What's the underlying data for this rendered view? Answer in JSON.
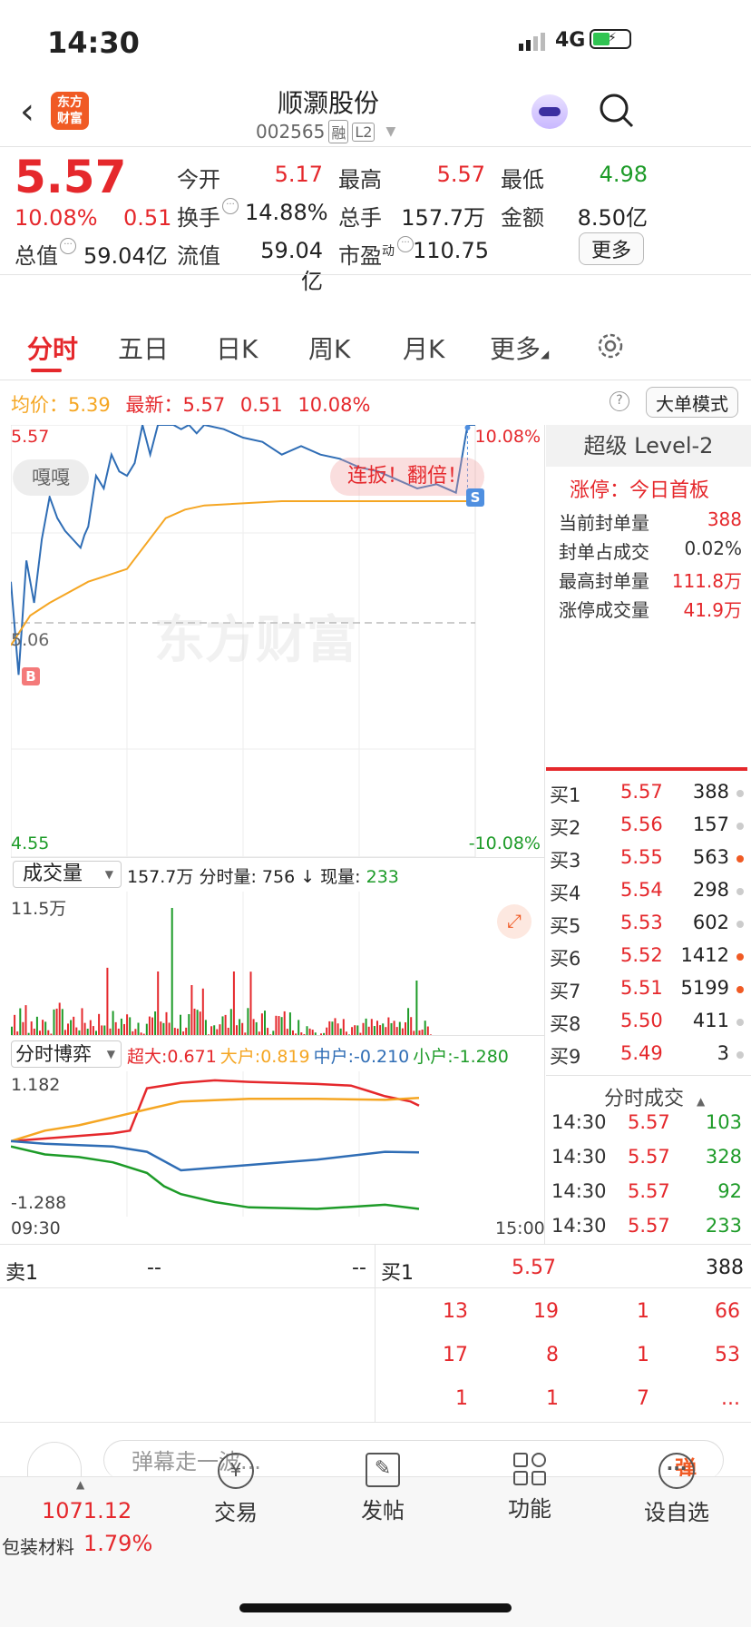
{
  "status": {
    "time": "14:30",
    "network": "4G"
  },
  "header": {
    "logo_line1": "东方",
    "logo_line2": "财富",
    "name": "顺灏股份",
    "code": "002565",
    "badge1": "融",
    "badge2": "L2"
  },
  "quote": {
    "price": "5.57",
    "pct": "10.08%",
    "chg": "0.51",
    "labels": {
      "open": "今开",
      "high": "最高",
      "low": "最低",
      "turnover": "换手",
      "volume": "总手",
      "amount": "金额",
      "mktcap": "总值",
      "float": "流值",
      "pe": "市盈",
      "pe_sup": "动"
    },
    "values": {
      "open": "5.17",
      "high": "5.57",
      "low": "4.98",
      "turnover": "14.88%",
      "volume": "157.7万",
      "amount": "8.50亿",
      "mktcap": "59.04亿",
      "float": "59.04亿",
      "pe": "110.75"
    },
    "more": "更多"
  },
  "tabs": [
    "分时",
    "五日",
    "日K",
    "周K",
    "月K",
    "更多"
  ],
  "chart_info": {
    "avg_label": "均价：",
    "avg": "5.39",
    "latest_label": "最新：",
    "latest": "5.57",
    "chg": "0.51",
    "pct": "10.08%",
    "mode": "大单模式"
  },
  "chart_data": [
    {
      "type": "line",
      "series": [
        {
          "name": "price",
          "color": "#2f6db5",
          "x": [
            0,
            4,
            8,
            12,
            16,
            20,
            24,
            28,
            32,
            36,
            38,
            40,
            44,
            48,
            52,
            56,
            60,
            64,
            68,
            72,
            76,
            80,
            84,
            88,
            92,
            96,
            100,
            110,
            120,
            130,
            140,
            150,
            160,
            170,
            180,
            190,
            200,
            210,
            220,
            230,
            236,
            240
          ],
          "values": [
            5.2,
            4.98,
            5.25,
            5.15,
            5.3,
            5.4,
            5.35,
            5.32,
            5.3,
            5.28,
            5.31,
            5.33,
            5.45,
            5.42,
            5.5,
            5.46,
            5.45,
            5.48,
            5.57,
            5.5,
            5.57,
            5.57,
            5.57,
            5.56,
            5.57,
            5.55,
            5.57,
            5.56,
            5.54,
            5.53,
            5.5,
            5.52,
            5.5,
            5.49,
            5.47,
            5.46,
            5.44,
            5.42,
            5.43,
            5.41,
            5.57,
            5.57
          ]
        },
        {
          "name": "avg",
          "color": "#f5a623",
          "x": [
            0,
            10,
            20,
            40,
            60,
            80,
            90,
            100,
            140,
            200,
            240
          ],
          "values": [
            5.05,
            5.12,
            5.15,
            5.2,
            5.23,
            5.35,
            5.37,
            5.38,
            5.39,
            5.39,
            5.39
          ]
        }
      ],
      "ylim": [
        4.55,
        5.57
      ],
      "prev_close": "5.06",
      "top_left": "5.57",
      "bottom_left": "4.55",
      "top_right": "10.08%",
      "bottom_right": "-10.08%",
      "marker_buy": "B",
      "marker_sell": "S",
      "watermark": "东方财富",
      "banner": "连扳！翻倍！",
      "tag": "嘎嘎"
    },
    {
      "type": "bar",
      "title": "成交量",
      "summary": "157.7万",
      "ymax_label": "11.5万",
      "fenshi_label": "分时量:",
      "fenshi_val": "756",
      "now_label": "现量:",
      "now_val": "233"
    },
    {
      "type": "line",
      "title": "分时博弈",
      "top": "1.182",
      "bottom": "-1.288",
      "x_start": "09:30",
      "x_end": "15:00",
      "series": [
        {
          "name": "超大",
          "value": "0.671",
          "color": "#e5282c",
          "x": [
            0,
            20,
            40,
            60,
            70,
            80,
            100,
            120,
            140,
            160,
            180,
            200,
            210,
            220,
            235,
            240
          ],
          "values": [
            0,
            0.05,
            0.1,
            0.15,
            0.2,
            1.0,
            1.1,
            1.15,
            1.12,
            1.1,
            1.08,
            1.05,
            0.95,
            0.85,
            0.75,
            0.671
          ]
        },
        {
          "name": "大户",
          "value": "0.819",
          "color": "#f5a623",
          "x": [
            0,
            20,
            40,
            60,
            80,
            100,
            140,
            180,
            220,
            240
          ],
          "values": [
            0,
            0.2,
            0.3,
            0.45,
            0.6,
            0.75,
            0.8,
            0.8,
            0.78,
            0.819
          ]
        },
        {
          "name": "中户",
          "value": "-0.210",
          "color": "#2f6db5",
          "x": [
            0,
            20,
            60,
            80,
            100,
            140,
            180,
            220,
            240
          ],
          "values": [
            0,
            -0.05,
            -0.1,
            -0.2,
            -0.55,
            -0.45,
            -0.35,
            -0.2,
            -0.21
          ]
        },
        {
          "name": "小户",
          "value": "-1.280",
          "color": "#1d9b28",
          "x": [
            0,
            20,
            40,
            60,
            80,
            90,
            100,
            120,
            140,
            180,
            220,
            240
          ],
          "values": [
            -0.1,
            -0.25,
            -0.3,
            -0.4,
            -0.6,
            -0.85,
            -1.0,
            -1.15,
            -1.25,
            -1.28,
            -1.2,
            -1.28
          ]
        }
      ]
    }
  ],
  "level2": {
    "title": "超级 Level-2",
    "limit_label": "涨停：",
    "limit_value": "今日首板",
    "rows": [
      {
        "k": "当前封单量",
        "v": "388"
      },
      {
        "k": "封单占成交",
        "v": "0.02%"
      },
      {
        "k": "最高封单量",
        "v": "111.8万"
      },
      {
        "k": "涨停成交量",
        "v": "41.9万"
      }
    ]
  },
  "orderbook": [
    {
      "l": "买1",
      "p": "5.57",
      "v": "388",
      "dot": "gray"
    },
    {
      "l": "买2",
      "p": "5.56",
      "v": "157",
      "dot": "gray"
    },
    {
      "l": "买3",
      "p": "5.55",
      "v": "563",
      "dot": "orange"
    },
    {
      "l": "买4",
      "p": "5.54",
      "v": "298",
      "dot": "gray"
    },
    {
      "l": "买5",
      "p": "5.53",
      "v": "602",
      "dot": "gray"
    },
    {
      "l": "买6",
      "p": "5.52",
      "v": "1412",
      "dot": "orange"
    },
    {
      "l": "买7",
      "p": "5.51",
      "v": "5199",
      "dot": "orange"
    },
    {
      "l": "买8",
      "p": "5.50",
      "v": "411",
      "dot": "gray"
    },
    {
      "l": "买9",
      "p": "5.49",
      "v": "3",
      "dot": "gray"
    }
  ],
  "trades_title": "分时成交",
  "trades": [
    {
      "t": "14:30",
      "p": "5.57",
      "v": "103"
    },
    {
      "t": "14:30",
      "p": "5.57",
      "v": "328"
    },
    {
      "t": "14:30",
      "p": "5.57",
      "v": "92"
    },
    {
      "t": "14:30",
      "p": "5.57",
      "v": "233"
    }
  ],
  "queue": {
    "sell_label": "卖1",
    "sell_p": "--",
    "sell_v": "--",
    "buy_label": "买1",
    "buy_p": "5.57",
    "buy_v": "388",
    "grid": [
      [
        "13",
        "19",
        "1",
        "66"
      ],
      [
        "17",
        "8",
        "1",
        "53"
      ],
      [
        "1",
        "1",
        "7",
        "..."
      ]
    ]
  },
  "danmu": {
    "placeholder": "弹幕走一波...",
    "btn": "弹"
  },
  "bottom": {
    "index_val": "1071.12",
    "index_name": "包装材料",
    "index_pct": "1.79%",
    "trade": "交易",
    "post": "发帖",
    "func": "功能",
    "watch": "设自选"
  }
}
